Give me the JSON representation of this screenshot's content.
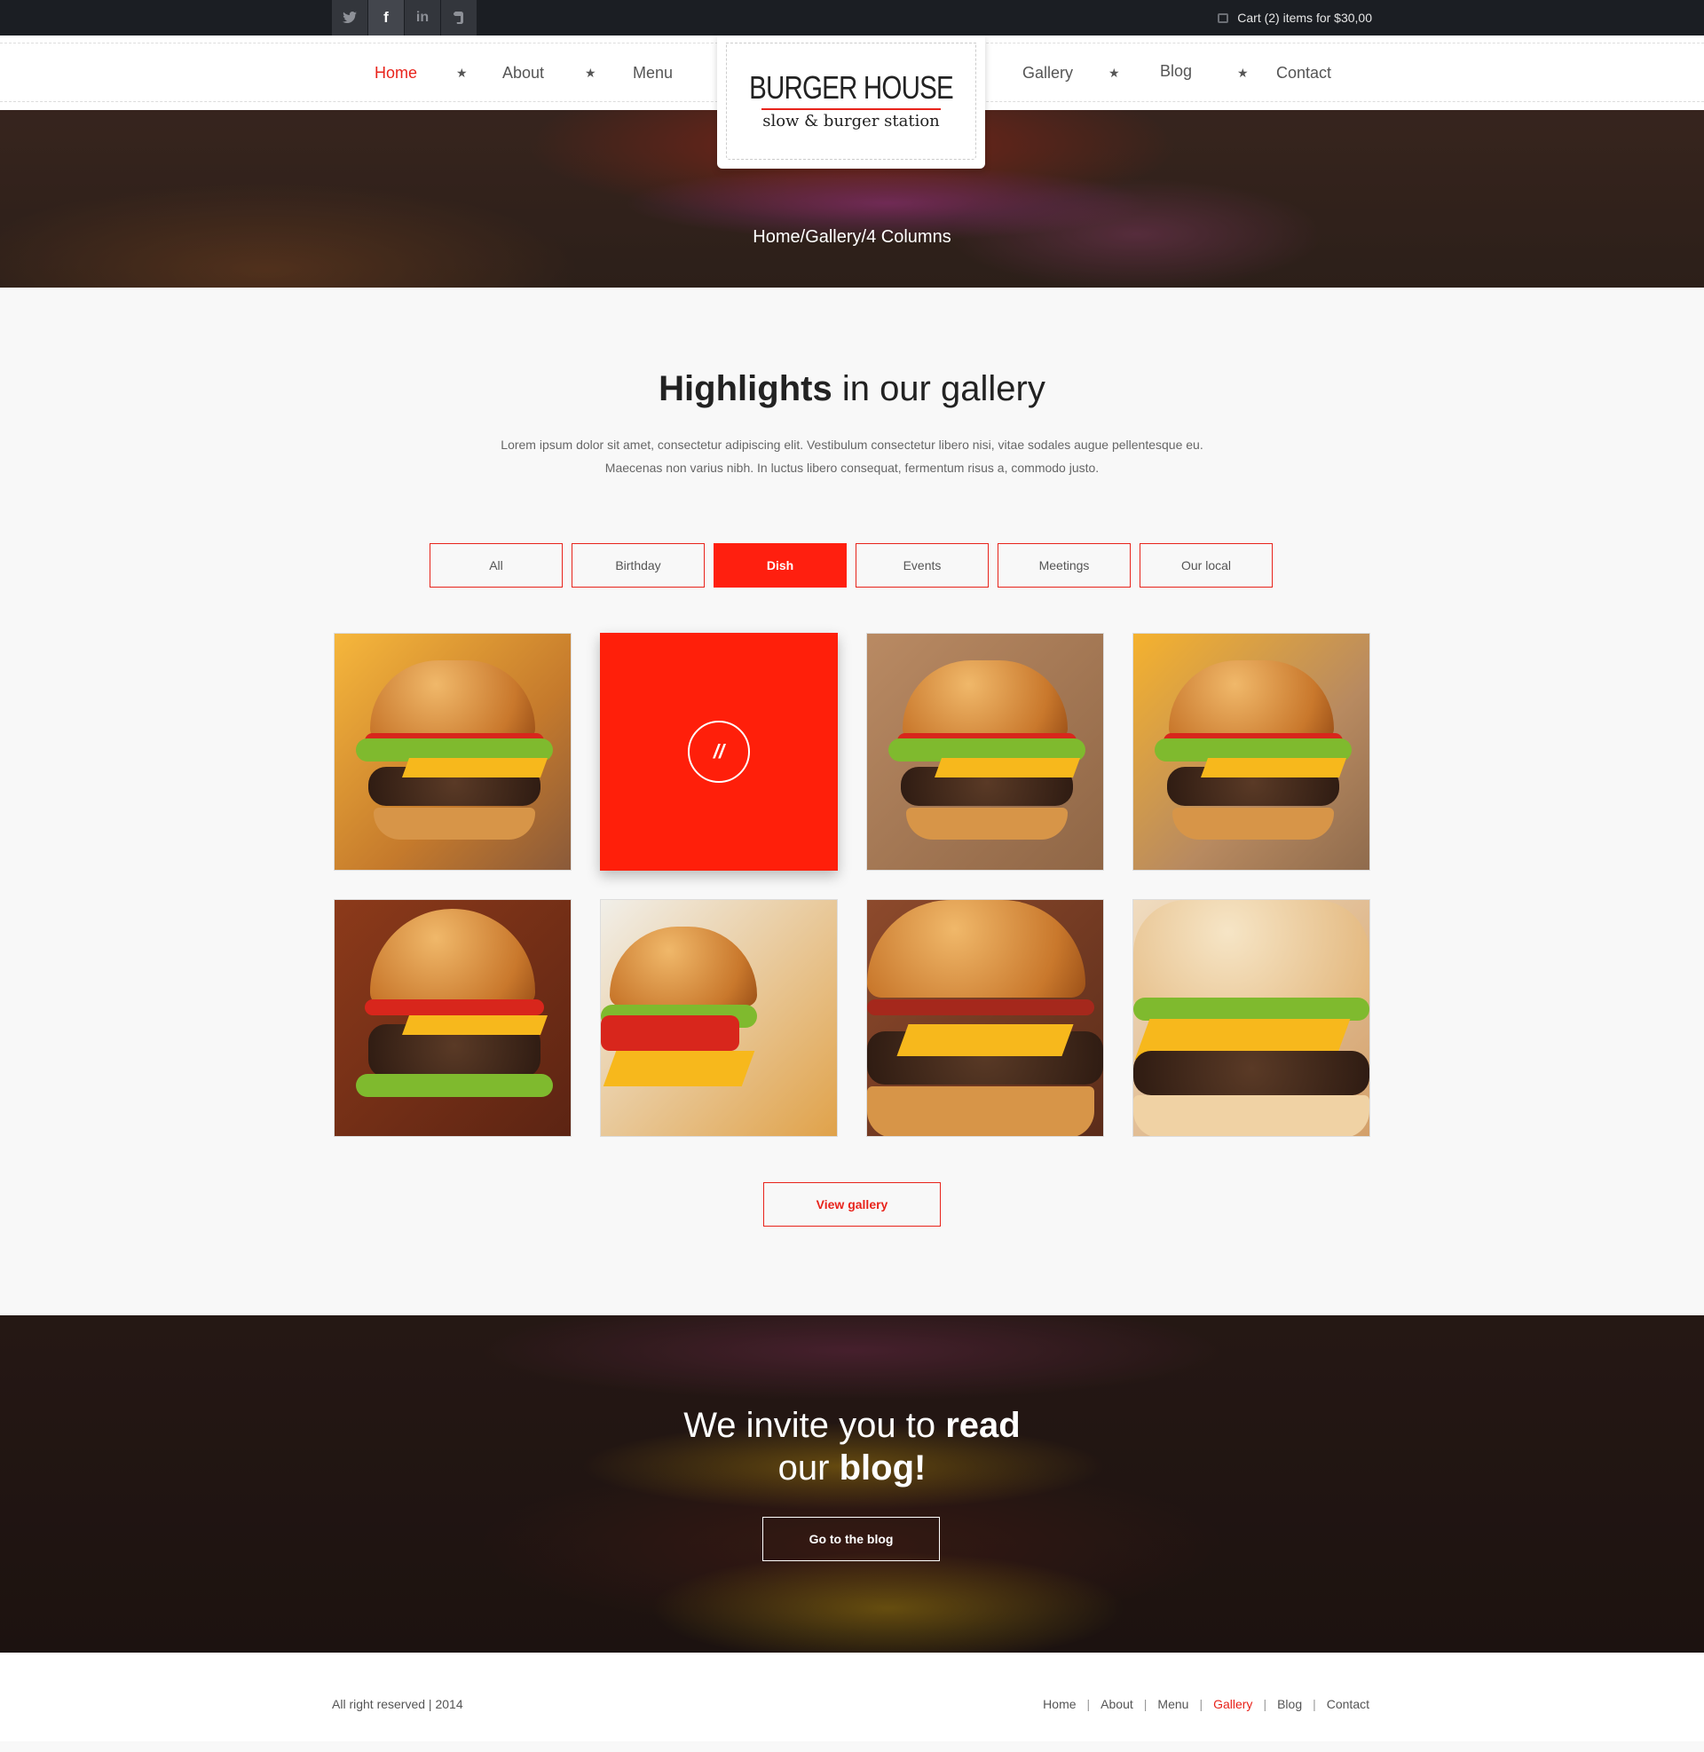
{
  "topbar": {
    "social": [
      {
        "name": "twitter-icon",
        "glyph": "t"
      },
      {
        "name": "facebook-icon",
        "glyph": "f"
      },
      {
        "name": "linkedin-icon",
        "glyph": "in"
      },
      {
        "name": "evernote-icon",
        "glyph": "e"
      }
    ],
    "cart_text": "Cart (2) items for $30,00"
  },
  "nav": {
    "left": [
      "Home",
      "About",
      "Menu"
    ],
    "right": [
      "Gallery",
      "Blog",
      "Contact"
    ],
    "active": "Home",
    "star": "★"
  },
  "logo": {
    "title": "BURGER HOUSE",
    "subtitle": "slow & burger station"
  },
  "hero": {
    "breadcrumb": "Home/Gallery/4 Columns"
  },
  "gallery": {
    "title_bold": "Highlights",
    "title_rest": " in our gallery",
    "description_line1": "Lorem ipsum dolor sit amet, consectetur adipiscing elit. Vestibulum consectetur libero nisi, vitae sodales augue pellentesque eu.",
    "description_line2": "Maecenas non varius nibh. In luctus libero consequat, fermentum risus a, commodo justo.",
    "filters": [
      "All",
      "Birthday",
      "Dish",
      "Events",
      "Meetings",
      "Our local"
    ],
    "active_filter": "Dish",
    "hover_icon": "//",
    "view_button": "View gallery"
  },
  "banner": {
    "line1_light": "We invite you to ",
    "line1_bold": "read",
    "line2_light": "our ",
    "line2_bold": "blog!",
    "button": "Go to the blog"
  },
  "footer": {
    "copyright": "All right reserved | 2014",
    "links": [
      "Home",
      "About",
      "Menu",
      "Gallery",
      "Blog",
      "Contact"
    ],
    "active": "Gallery"
  },
  "colors": {
    "accent": "#e8231b",
    "topbar": "#1b1e23"
  }
}
